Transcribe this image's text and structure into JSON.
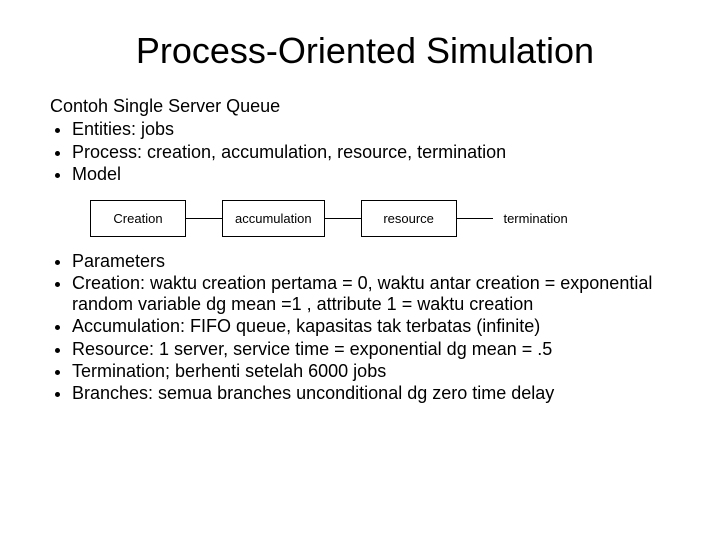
{
  "title": "Process-Oriented Simulation",
  "subhead": "Contoh Single Server Queue",
  "top_bullets": [
    "Entities: jobs",
    "Process: creation, accumulation, resource, termination",
    "Model"
  ],
  "diagram": {
    "boxes": [
      "Creation",
      "accumulation",
      "resource",
      "termination"
    ]
  },
  "bottom_bullets": [
    "Parameters",
    "Creation: waktu creation pertama = 0, waktu antar creation = exponential random variable dg mean =1 , attribute 1 = waktu creation",
    "Accumulation: FIFO queue, kapasitas tak terbatas (infinite)",
    "Resource: 1 server, service time = exponential dg mean = .5",
    "Termination; berhenti setelah 6000 jobs",
    "Branches: semua branches unconditional dg zero time delay"
  ]
}
